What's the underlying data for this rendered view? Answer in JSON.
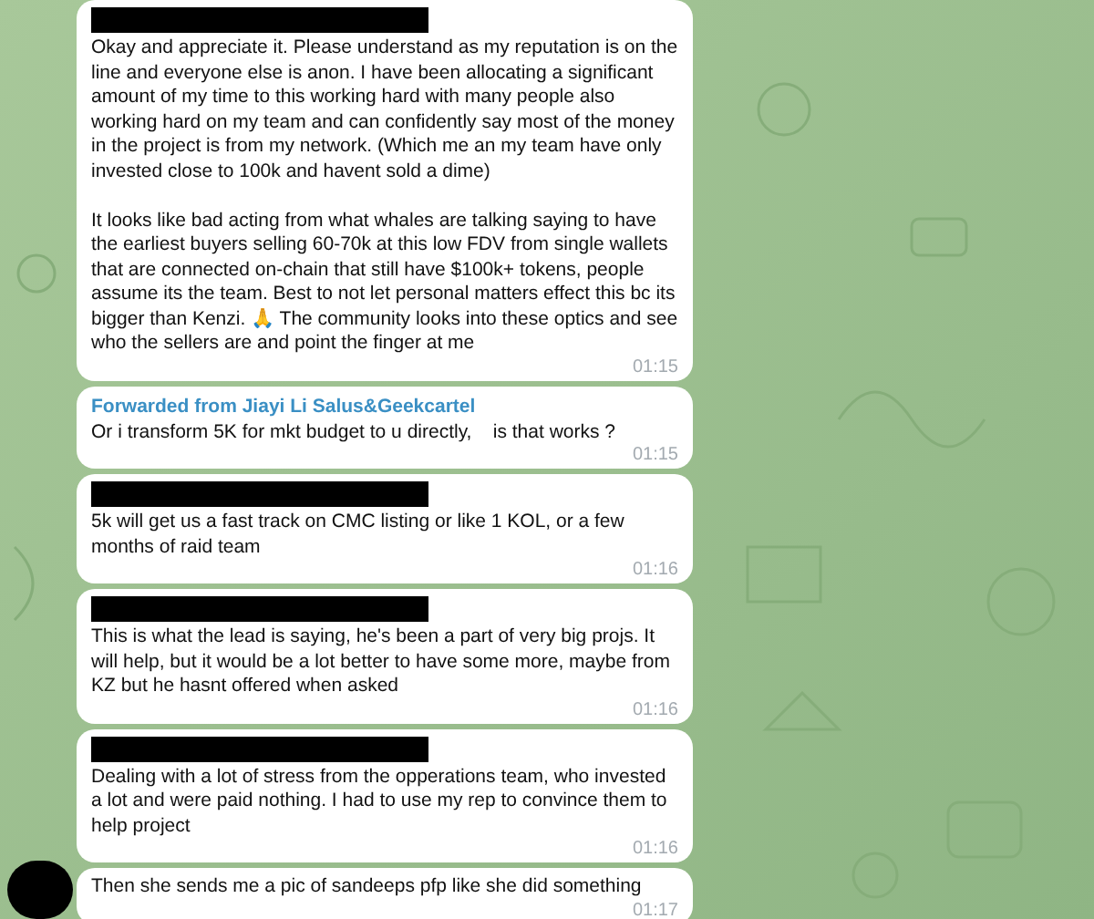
{
  "messages": [
    {
      "redacted": true,
      "text": "Okay and appreciate it. Please understand as my reputation is on the line and everyone else is anon. I have been allocating a significant amount of my time to this working hard with many people also working hard on my team and can confidently say most of the money in the project is from my network. (Which me an my team have only invested close to 100k and havent sold a dime)\n\nIt looks like bad acting from what whales are talking saying to have the earliest buyers selling 60-70k at this low FDV from single wallets that are connected on-chain that still have $100k+ tokens, people assume its the team. Best to not let personal matters effect this bc its bigger than Kenzi. 🙏 The community looks into these optics and see who the sellers are and point the finger at me",
      "time": "01:15"
    },
    {
      "redacted": false,
      "forwarded_from": "Forwarded from Jiayi Li Salus&Geekcartel",
      "text": "Or i transform 5K for mkt budget to u directly,    is that works ?",
      "time": "01:15"
    },
    {
      "redacted": true,
      "text": "5k will get us a fast track on CMC listing or like 1 KOL, or a few months of raid team",
      "time": "01:16"
    },
    {
      "redacted": true,
      "text": "This is what the lead is saying, he's been a part of very big projs. It will help, but it would be a lot better to have some more, maybe from KZ but he hasnt offered when asked",
      "time": "01:16"
    },
    {
      "redacted": true,
      "text": "Dealing with a lot of stress from the opperations team, who invested a lot and were paid nothing. I had to use my rep to convince them to help project",
      "time": "01:16"
    },
    {
      "redacted": false,
      "text": "Then she sends me a pic of sandeeps pfp like she did something",
      "time": "01:17"
    }
  ],
  "avatar": {
    "redacted": true
  }
}
